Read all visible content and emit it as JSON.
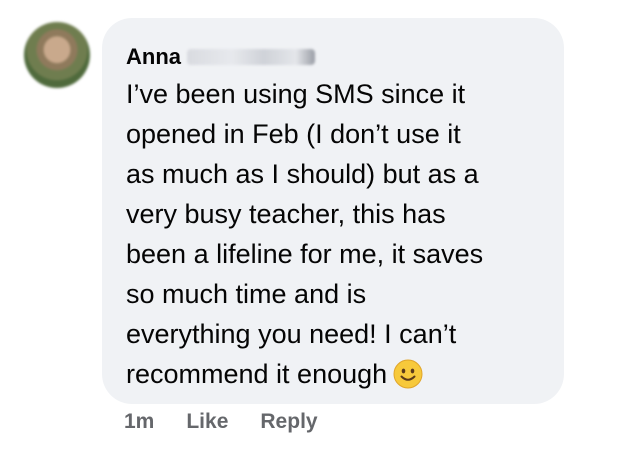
{
  "comment": {
    "author_first_name": "Anna",
    "author_last_name_redacted": true,
    "lines": [
      "I’ve been using SMS since it",
      "opened in Feb (I don’t use it",
      "as much as I should) but as a",
      "very busy teacher, this has",
      "been a lifeline for me, it saves",
      "so much time and is",
      "everything you need! I can’t",
      "recommend it enough"
    ],
    "emoji": "slightly-smiling-face-icon"
  },
  "actions": {
    "timestamp": "1m",
    "like_label": "Like",
    "reply_label": "Reply"
  }
}
